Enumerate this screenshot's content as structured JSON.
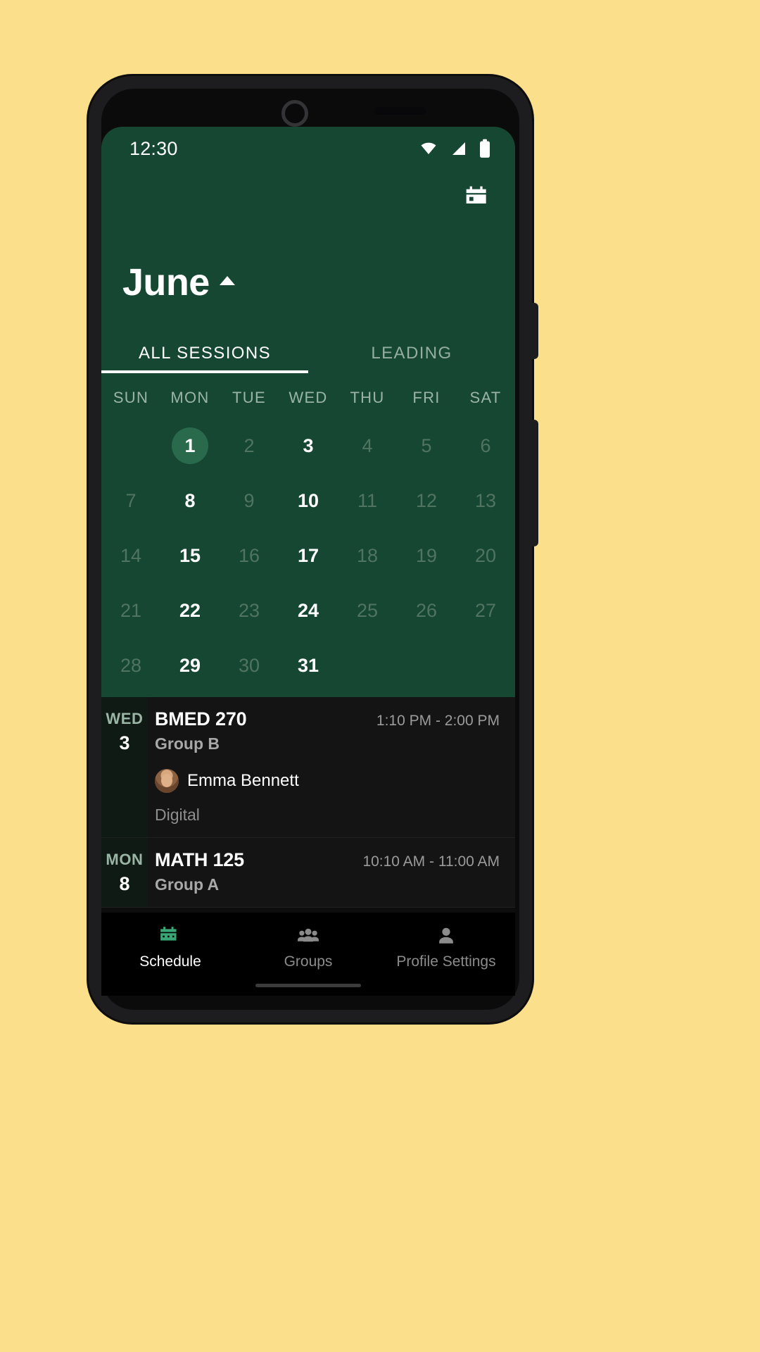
{
  "status_bar": {
    "time": "12:30",
    "icons": [
      "wifi-icon",
      "cellular-signal-icon",
      "battery-icon"
    ]
  },
  "header": {
    "calendar_action_icon": "calendar-icon",
    "month": "June",
    "collapse_icon": "caret-up-icon"
  },
  "tabs": [
    {
      "label": "ALL SESSIONS",
      "active": true
    },
    {
      "label": "LEADING",
      "active": false
    }
  ],
  "calendar": {
    "weekday_headers": [
      "SUN",
      "MON",
      "TUE",
      "WED",
      "THU",
      "FRI",
      "SAT"
    ],
    "weeks": [
      [
        {
          "day": "",
          "state": "empty"
        },
        {
          "day": "1",
          "state": "selected"
        },
        {
          "day": "2",
          "state": "dim"
        },
        {
          "day": "3",
          "state": "has-session"
        },
        {
          "day": "4",
          "state": "dim"
        },
        {
          "day": "5",
          "state": "dim"
        },
        {
          "day": "6",
          "state": "dim"
        }
      ],
      [
        {
          "day": "7",
          "state": "dim"
        },
        {
          "day": "8",
          "state": "has-session"
        },
        {
          "day": "9",
          "state": "dim"
        },
        {
          "day": "10",
          "state": "has-session"
        },
        {
          "day": "11",
          "state": "dim"
        },
        {
          "day": "12",
          "state": "dim"
        },
        {
          "day": "13",
          "state": "dim"
        }
      ],
      [
        {
          "day": "14",
          "state": "dim"
        },
        {
          "day": "15",
          "state": "has-session"
        },
        {
          "day": "16",
          "state": "dim"
        },
        {
          "day": "17",
          "state": "has-session"
        },
        {
          "day": "18",
          "state": "dim"
        },
        {
          "day": "19",
          "state": "dim"
        },
        {
          "day": "20",
          "state": "dim"
        }
      ],
      [
        {
          "day": "21",
          "state": "dim"
        },
        {
          "day": "22",
          "state": "has-session"
        },
        {
          "day": "23",
          "state": "dim"
        },
        {
          "day": "24",
          "state": "has-session"
        },
        {
          "day": "25",
          "state": "dim"
        },
        {
          "day": "26",
          "state": "dim"
        },
        {
          "day": "27",
          "state": "dim"
        }
      ],
      [
        {
          "day": "28",
          "state": "dim"
        },
        {
          "day": "29",
          "state": "has-session"
        },
        {
          "day": "30",
          "state": "dim"
        },
        {
          "day": "31",
          "state": "has-session"
        },
        {
          "day": "",
          "state": "empty"
        },
        {
          "day": "",
          "state": "empty"
        },
        {
          "day": "",
          "state": "empty"
        }
      ]
    ]
  },
  "sessions": [
    {
      "weekday": "WED",
      "day": "3",
      "code": "BMED 270",
      "time": "1:10 PM - 2:00 PM",
      "group": "Group B",
      "person": "Emma Bennett",
      "mode": "Digital"
    },
    {
      "weekday": "MON",
      "day": "8",
      "code": "MATH 125",
      "time": "10:10 AM - 11:00 AM",
      "group": "Group A",
      "person": "",
      "mode": ""
    }
  ],
  "bottom_nav": [
    {
      "label": "Schedule",
      "icon": "calendar-icon",
      "active": true
    },
    {
      "label": "Groups",
      "icon": "people-icon",
      "active": false
    },
    {
      "label": "Profile Settings",
      "icon": "person-icon",
      "active": false
    }
  ],
  "colors": {
    "page_background": "#fbdf8b",
    "header_green": "#164733",
    "accent_green": "#3aa676",
    "selected_day": "#2a6a4c",
    "list_background": "#141414"
  }
}
